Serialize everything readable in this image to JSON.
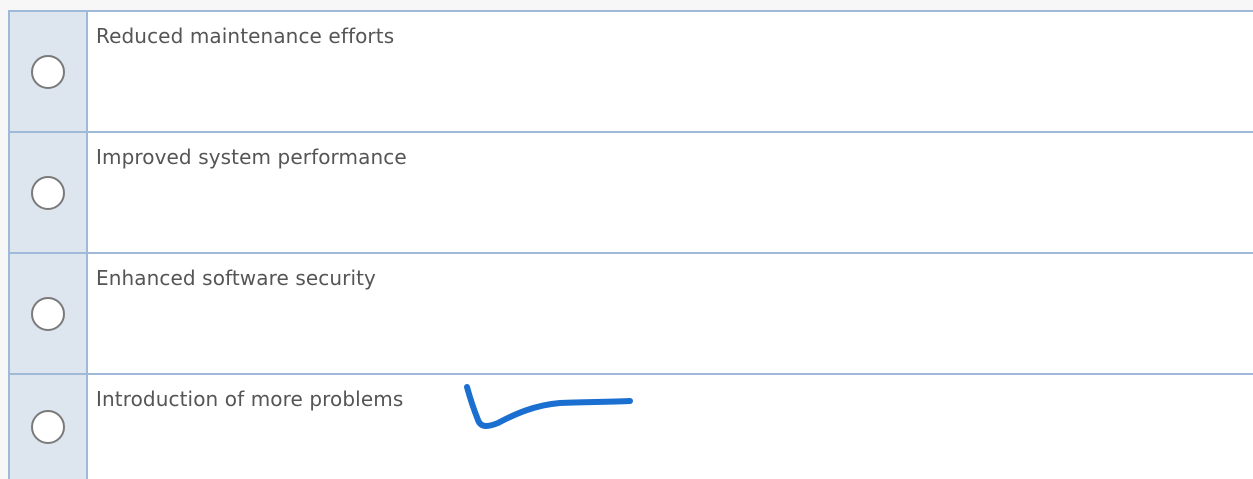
{
  "options": [
    {
      "label": "Reduced maintenance efforts"
    },
    {
      "label": "Improved system performance"
    },
    {
      "label": "Enhanced software security"
    },
    {
      "label": "Introduction of more problems"
    }
  ],
  "annotation": {
    "color": "#1a6fd1",
    "marked_option_index": 3
  }
}
